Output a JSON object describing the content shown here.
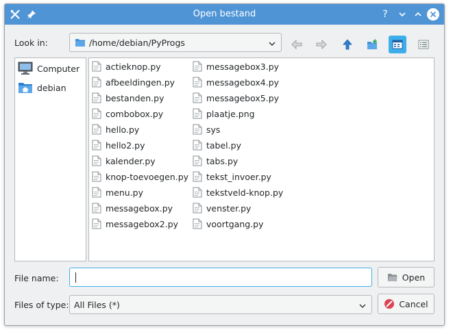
{
  "window": {
    "title": "Open bestand"
  },
  "look_in": {
    "label": "Look in:",
    "path": "/home/debian/PyProgs"
  },
  "sidebar": {
    "items": [
      {
        "label": "Computer",
        "icon": "computer-icon"
      },
      {
        "label": "debian",
        "icon": "home-folder-icon"
      }
    ]
  },
  "files": {
    "column1": [
      "actieknop.py",
      "afbeeldingen.py",
      "bestanden.py",
      "combobox.py",
      "hello.py",
      "hello2.py",
      "kalender.py",
      "knop-toevoegen.py",
      "menu.py",
      "messagebox.py",
      "messagebox2.py"
    ],
    "column2": [
      "messagebox3.py",
      "messagebox4.py",
      "messagebox5.py",
      "plaatje.png",
      "sys",
      "tabel.py",
      "tabs.py",
      "tekst_invoer.py",
      "tekstveld-knop.py",
      "venster.py",
      "voortgang.py"
    ]
  },
  "file_name": {
    "label": "File name:",
    "value": ""
  },
  "file_type": {
    "label": "Files of type:",
    "value": "All Files (*)"
  },
  "buttons": {
    "open": "Open",
    "cancel": "Cancel"
  },
  "colors": {
    "accent": "#3daee9",
    "titlebar": "#4f95d6"
  }
}
